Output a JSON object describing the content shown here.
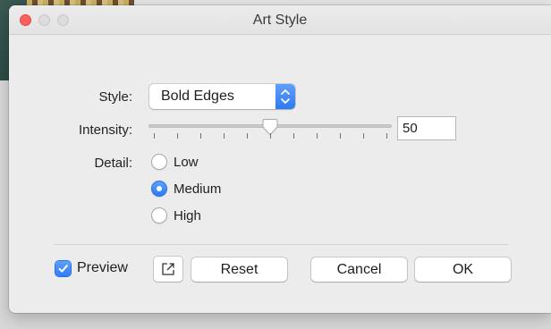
{
  "window": {
    "title": "Art Style"
  },
  "style": {
    "label": "Style:",
    "selected": "Bold Edges"
  },
  "intensity": {
    "label": "Intensity:",
    "value": "50",
    "min": 0,
    "max": 100
  },
  "detail": {
    "label": "Detail:",
    "options": [
      {
        "label": "Low",
        "selected": false
      },
      {
        "label": "Medium",
        "selected": true
      },
      {
        "label": "High",
        "selected": false
      }
    ]
  },
  "footer": {
    "preview_label": "Preview",
    "preview_checked": true,
    "expand_icon": "resize-arrow-icon",
    "reset_label": "Reset",
    "cancel_label": "Cancel",
    "ok_label": "OK"
  },
  "colors": {
    "accent": "#2f7bf2",
    "close": "#fc605c"
  }
}
